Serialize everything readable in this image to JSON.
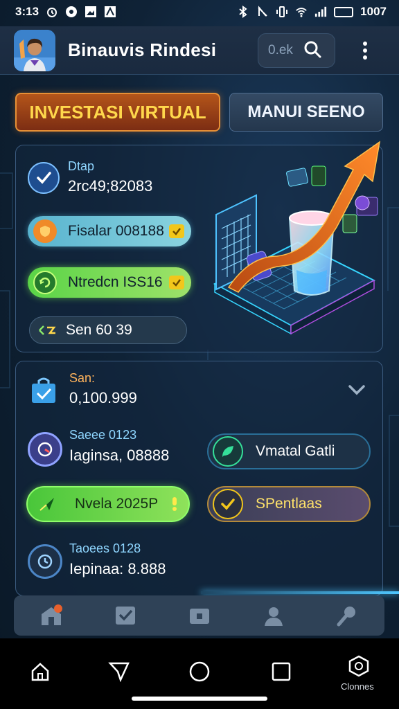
{
  "status_bar": {
    "time": "3:13",
    "battery_label": "1007",
    "icons": [
      "alarm-icon",
      "media-icon",
      "gallery-icon",
      "notification-icon",
      "bluetooth-icon",
      "mute-icon",
      "vibrate-icon",
      "wifi-icon",
      "signal-icon",
      "battery-icon"
    ]
  },
  "header": {
    "app_title": "Binauvis Rindesi",
    "search_text": "0.ek",
    "avatar": "avatar-icon",
    "menu_icon": "kebab-menu-icon"
  },
  "tabs": [
    {
      "label": "INVESTASI VIRTUAL",
      "active": true
    },
    {
      "label": "MANUI SEENO",
      "active": false
    }
  ],
  "portfolio": {
    "title_small": "Dtap",
    "value": "2rc49;82083",
    "pills": [
      {
        "label": "Fisalar 008188",
        "icon": "shield-icon"
      },
      {
        "label": "Ntredcn ISS16",
        "icon": "refresh-icon"
      },
      {
        "label": "Sen 60 39",
        "icon": "transfer-icon"
      }
    ],
    "illustration": "investment-growth-illustration"
  },
  "summary": {
    "title_small": "San:",
    "value": "0,100.999",
    "collapse_icon": "chevron-icon",
    "stat_1": {
      "small": "Saeee 0123",
      "big": "Iaginsa, 08888"
    },
    "stat_2": {
      "small": "Taoees 0128",
      "big": "Iepinaa: 8.888"
    },
    "buttons": [
      {
        "label": "Vmatal Gatli",
        "icon": "leaf-icon"
      },
      {
        "label": "Nvela 2025P",
        "icon": "send-icon"
      },
      {
        "label": "SPentlaas",
        "icon": "check-icon"
      }
    ]
  },
  "app_nav": [
    "home-app-icon",
    "tasks-icon",
    "wallet-icon",
    "profile-icon",
    "settings-icon"
  ],
  "system_nav": {
    "label": "Clonnes",
    "icons": [
      "home-icon",
      "share-icon",
      "circle-home-icon",
      "recents-icon",
      "clones-icon"
    ]
  },
  "colors": {
    "accent_orange": "#e79036",
    "accent_yellow": "#ffd84c",
    "accent_green": "#8fff6a",
    "accent_blue": "#4fc7ff",
    "background": "#0f2236"
  }
}
